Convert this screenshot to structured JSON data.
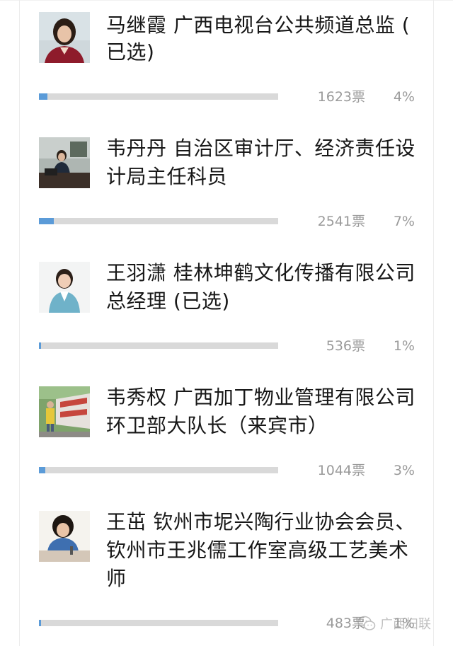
{
  "candidates": [
    {
      "line1": "马继霞 广西电视台公共频道总监 (",
      "line2": "已选",
      "line3": "",
      "line2_suffix": ")",
      "votes": "1623票",
      "percent": "4%",
      "share": 0.04,
      "photo": "woman-portrait-photo"
    },
    {
      "line1": "韦丹丹 自治区审计厅、经济责任设",
      "line2": "计局主任科员",
      "line3": "",
      "line2_suffix": "",
      "votes": "2541票",
      "percent": "7%",
      "share": 0.07,
      "photo": "woman-at-desk-photo"
    },
    {
      "line1": "王羽潇 桂林坤鹤文化传播有限公司",
      "line2": "总经理 (已选)",
      "line3": "",
      "line2_suffix": "",
      "votes": "536票",
      "percent": "1%",
      "share": 0.01,
      "photo": "woman-smiling-photo"
    },
    {
      "line1": "韦秀权 广西加丁物业管理有限公司",
      "line2": "环卫部大队长（来宾市）",
      "line3": "",
      "line2_suffix": "",
      "votes": "1044票",
      "percent": "3%",
      "share": 0.03,
      "photo": "street-worker-photo"
    },
    {
      "line1": "王茁 钦州市坭兴陶行业协会会员、",
      "line2": "钦州市王兆儒工作室高级工艺美术",
      "line3": "师",
      "line2_suffix": "",
      "votes": "483票",
      "percent": "1%",
      "share": 0.01,
      "photo": "artisan-working-photo"
    }
  ],
  "watermark": {
    "text": "广西妇联",
    "icon": "wechat-icon"
  },
  "colors": {
    "bar_fill": "#5b9bd8",
    "bar_track": "#d9d9d9",
    "meta_text": "#9a9a9a"
  }
}
